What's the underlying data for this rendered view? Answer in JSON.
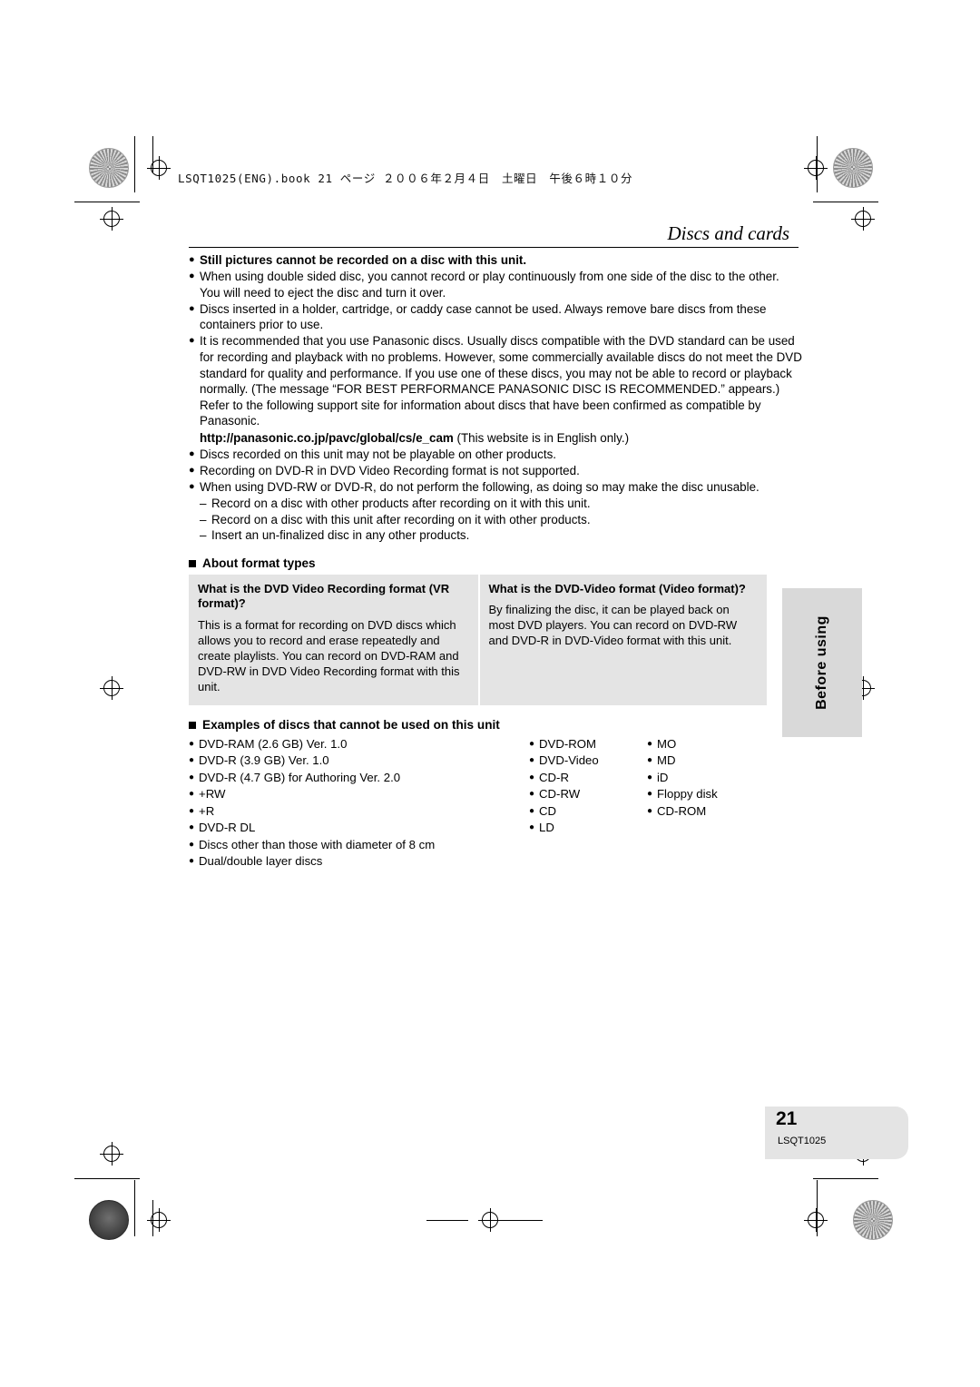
{
  "header": {
    "book_line": "LSQT1025(ENG).book  21 ページ  ２００６年２月４日　土曜日　午後６時１０分",
    "chapter_title": "Discs and cards"
  },
  "bullets": [
    {
      "bold": true,
      "text": "Still pictures cannot be recorded on a disc with this unit."
    },
    {
      "bold": false,
      "text": "When using double sided disc, you cannot record or play continuously from one side of the disc to the other. You will need to eject the disc and turn it over."
    },
    {
      "bold": false,
      "text": "Discs inserted in a holder, cartridge, or caddy case cannot be used. Always remove bare discs from these containers prior to use."
    },
    {
      "bold": false,
      "text": "It is recommended that you use Panasonic discs. Usually discs compatible with the DVD standard can be used for recording and playback with no problems. However, some commercially available discs do not meet the DVD standard for quality and performance. If you use one of these discs, you may not be able to record or playback normally. (The message “FOR BEST PERFORMANCE PANASONIC DISC IS RECOMMENDED.” appears.) Refer to the following support site for information about discs that have been confirmed as compatible by Panasonic."
    },
    {
      "bold": false,
      "text": "Discs recorded on this unit may not be playable on other products."
    },
    {
      "bold": false,
      "text": "Recording on DVD-R in DVD Video Recording format is not supported."
    },
    {
      "bold": false,
      "text": "When using DVD-RW or DVD-R, do not perform the following, as doing so may make the disc unusable."
    }
  ],
  "url_line": {
    "url": "http://panasonic.co.jp/pavc/global/cs/e_cam",
    "note": " (This website is in English only.)"
  },
  "dashes": [
    "Record on a disc with other products after recording on it with this unit.",
    "Record on a disc with this unit after recording on it with other products.",
    "Insert an un-finalized disc in any other products."
  ],
  "format_section": {
    "heading": "About format types",
    "columns": [
      {
        "title": "What is the DVD Video Recording format (VR format)?",
        "body": "This is a format for recording on DVD discs which allows you to record and erase repeatedly and create playlists. You can record on DVD-RAM and DVD-RW in DVD Video Recording format with this unit."
      },
      {
        "title": "What is the DVD-Video format (Video format)?",
        "body": "By finalizing the disc, it can be played back on most DVD players.\nYou can record on DVD-RW and DVD-R in DVD-Video format with this unit."
      }
    ]
  },
  "examples_section": {
    "heading": "Examples of discs that cannot be used on this unit",
    "column1": [
      "DVD-RAM (2.6 GB) Ver. 1.0",
      "DVD-R (3.9 GB) Ver. 1.0",
      "DVD-R (4.7 GB) for Authoring Ver. 2.0",
      "+RW",
      "+R",
      "DVD-R DL"
    ],
    "column1_extra": [
      "Discs other than those with diameter of 8 cm",
      "Dual/double layer discs"
    ],
    "column2": [
      "DVD-ROM",
      "DVD-Video",
      "CD-R",
      "CD-RW",
      "CD",
      "LD"
    ],
    "column3": [
      "MO",
      "MD",
      "iD",
      "Floppy disk",
      "CD-ROM"
    ]
  },
  "side_tab": {
    "label": "Before using"
  },
  "page_footer": {
    "number": "21",
    "code": "LSQT1025"
  }
}
